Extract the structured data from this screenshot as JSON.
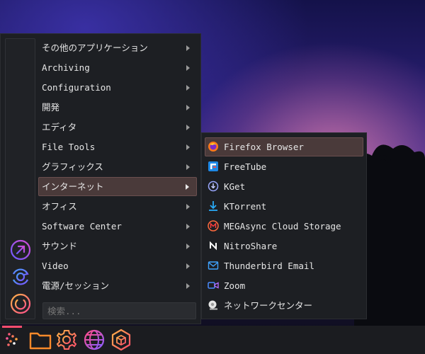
{
  "categories": [
    {
      "label": "その他のアプリケーション"
    },
    {
      "label": "Archiving"
    },
    {
      "label": "Configuration"
    },
    {
      "label": "開発"
    },
    {
      "label": "エディタ"
    },
    {
      "label": "File Tools"
    },
    {
      "label": "グラフィックス"
    },
    {
      "label": "インターネット",
      "active": true
    },
    {
      "label": "オフィス"
    },
    {
      "label": "Software Center"
    },
    {
      "label": "サウンド"
    },
    {
      "label": "Video"
    },
    {
      "label": "電源/セッション"
    }
  ],
  "search": {
    "placeholder": "検索..."
  },
  "submenu": {
    "items": [
      {
        "label": "Firefox Browser",
        "icon": "firefox-icon",
        "active": true
      },
      {
        "label": "FreeTube",
        "icon": "freetube-icon"
      },
      {
        "label": "KGet",
        "icon": "kget-icon"
      },
      {
        "label": "KTorrent",
        "icon": "ktorrent-icon"
      },
      {
        "label": "MEGAsync Cloud Storage",
        "icon": "megasync-icon"
      },
      {
        "label": "NitroShare",
        "icon": "nitroshare-icon"
      },
      {
        "label": "Thunderbird Email",
        "icon": "thunderbird-icon"
      },
      {
        "label": "Zoom",
        "icon": "zoom-icon"
      },
      {
        "label": "ネットワークセンター",
        "icon": "network-center-icon"
      }
    ]
  },
  "rail": {
    "buttons": [
      "launch-icon",
      "refresh-icon",
      "power-icon"
    ]
  },
  "taskbar": {
    "items": [
      "app-launcher-icon",
      "folder-icon",
      "settings-gear-icon",
      "browser-globe-icon",
      "package-icon"
    ]
  }
}
